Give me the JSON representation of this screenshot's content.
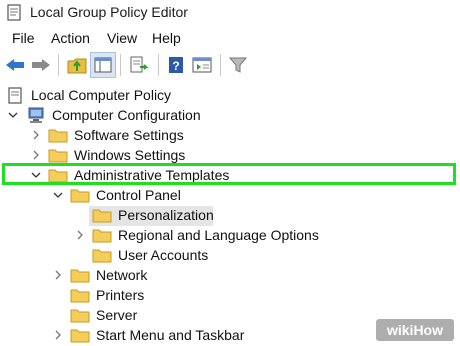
{
  "window": {
    "title": "Local Group Policy Editor"
  },
  "menu": {
    "file": "File",
    "action": "Action",
    "view": "View",
    "help": "Help"
  },
  "toolbar": {
    "buttons": [
      "back-arrow",
      "forward-arrow",
      "up-folder",
      "show-hide-console-tree",
      "export-list",
      "help",
      "properties-view",
      "filter"
    ]
  },
  "tree": {
    "root": "Local Computer Policy",
    "computer_config": "Computer Configuration",
    "software_settings": "Software Settings",
    "windows_settings": "Windows Settings",
    "admin_templates": "Administrative Templates",
    "control_panel": "Control Panel",
    "personalization": "Personalization",
    "regional": "Regional and Language Options",
    "user_accounts": "User Accounts",
    "network": "Network",
    "printers": "Printers",
    "server": "Server",
    "start_menu": "Start Menu and Taskbar"
  },
  "watermark": {
    "text": "wikiHow"
  },
  "colors": {
    "highlight": "#1fe01f",
    "folder": "#f4cd5a",
    "selection": "#e5e5e5"
  }
}
